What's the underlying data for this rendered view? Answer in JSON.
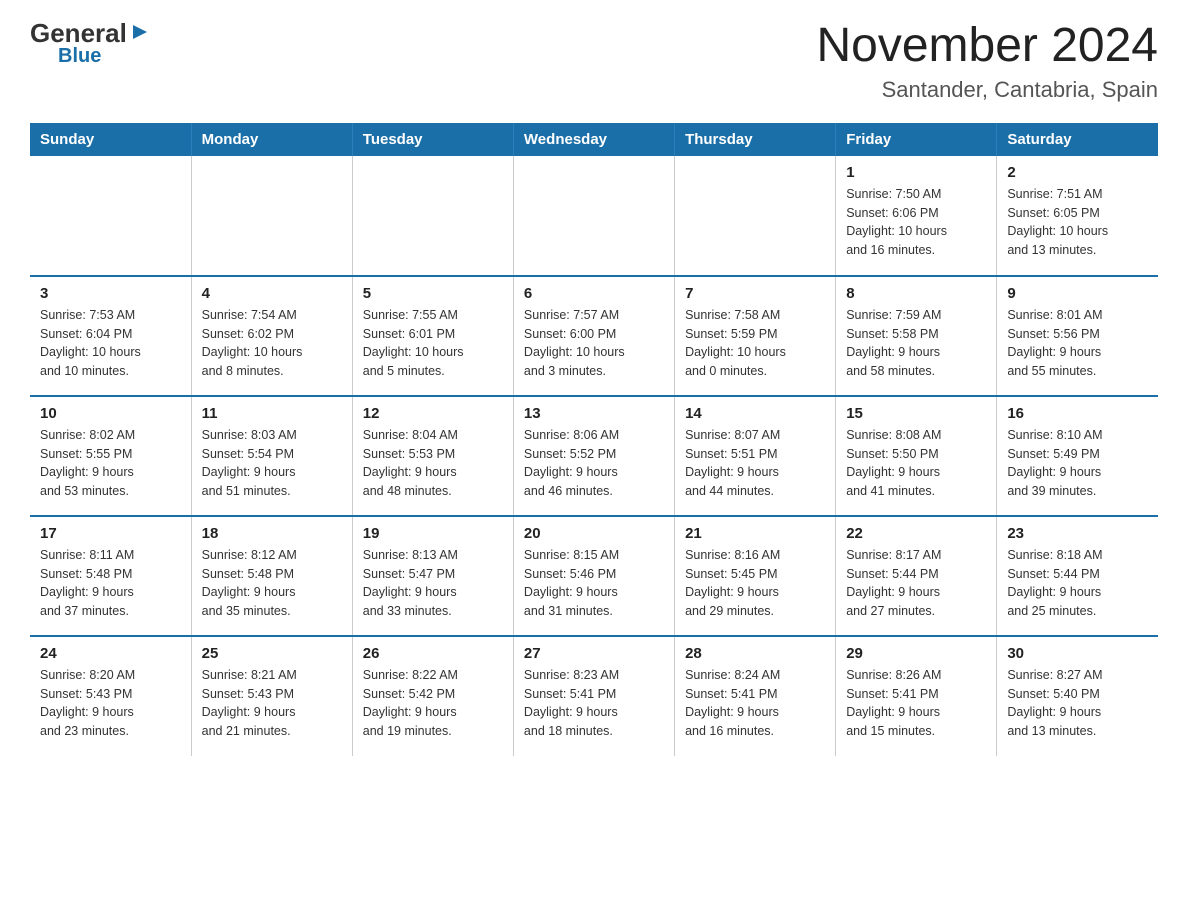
{
  "logo": {
    "general": "General",
    "blue": "Blue",
    "triangle": "▶"
  },
  "title": "November 2024",
  "subtitle": "Santander, Cantabria, Spain",
  "weekdays": [
    "Sunday",
    "Monday",
    "Tuesday",
    "Wednesday",
    "Thursday",
    "Friday",
    "Saturday"
  ],
  "weeks": [
    [
      {
        "day": "",
        "info": ""
      },
      {
        "day": "",
        "info": ""
      },
      {
        "day": "",
        "info": ""
      },
      {
        "day": "",
        "info": ""
      },
      {
        "day": "",
        "info": ""
      },
      {
        "day": "1",
        "info": "Sunrise: 7:50 AM\nSunset: 6:06 PM\nDaylight: 10 hours\nand 16 minutes."
      },
      {
        "day": "2",
        "info": "Sunrise: 7:51 AM\nSunset: 6:05 PM\nDaylight: 10 hours\nand 13 minutes."
      }
    ],
    [
      {
        "day": "3",
        "info": "Sunrise: 7:53 AM\nSunset: 6:04 PM\nDaylight: 10 hours\nand 10 minutes."
      },
      {
        "day": "4",
        "info": "Sunrise: 7:54 AM\nSunset: 6:02 PM\nDaylight: 10 hours\nand 8 minutes."
      },
      {
        "day": "5",
        "info": "Sunrise: 7:55 AM\nSunset: 6:01 PM\nDaylight: 10 hours\nand 5 minutes."
      },
      {
        "day": "6",
        "info": "Sunrise: 7:57 AM\nSunset: 6:00 PM\nDaylight: 10 hours\nand 3 minutes."
      },
      {
        "day": "7",
        "info": "Sunrise: 7:58 AM\nSunset: 5:59 PM\nDaylight: 10 hours\nand 0 minutes."
      },
      {
        "day": "8",
        "info": "Sunrise: 7:59 AM\nSunset: 5:58 PM\nDaylight: 9 hours\nand 58 minutes."
      },
      {
        "day": "9",
        "info": "Sunrise: 8:01 AM\nSunset: 5:56 PM\nDaylight: 9 hours\nand 55 minutes."
      }
    ],
    [
      {
        "day": "10",
        "info": "Sunrise: 8:02 AM\nSunset: 5:55 PM\nDaylight: 9 hours\nand 53 minutes."
      },
      {
        "day": "11",
        "info": "Sunrise: 8:03 AM\nSunset: 5:54 PM\nDaylight: 9 hours\nand 51 minutes."
      },
      {
        "day": "12",
        "info": "Sunrise: 8:04 AM\nSunset: 5:53 PM\nDaylight: 9 hours\nand 48 minutes."
      },
      {
        "day": "13",
        "info": "Sunrise: 8:06 AM\nSunset: 5:52 PM\nDaylight: 9 hours\nand 46 minutes."
      },
      {
        "day": "14",
        "info": "Sunrise: 8:07 AM\nSunset: 5:51 PM\nDaylight: 9 hours\nand 44 minutes."
      },
      {
        "day": "15",
        "info": "Sunrise: 8:08 AM\nSunset: 5:50 PM\nDaylight: 9 hours\nand 41 minutes."
      },
      {
        "day": "16",
        "info": "Sunrise: 8:10 AM\nSunset: 5:49 PM\nDaylight: 9 hours\nand 39 minutes."
      }
    ],
    [
      {
        "day": "17",
        "info": "Sunrise: 8:11 AM\nSunset: 5:48 PM\nDaylight: 9 hours\nand 37 minutes."
      },
      {
        "day": "18",
        "info": "Sunrise: 8:12 AM\nSunset: 5:48 PM\nDaylight: 9 hours\nand 35 minutes."
      },
      {
        "day": "19",
        "info": "Sunrise: 8:13 AM\nSunset: 5:47 PM\nDaylight: 9 hours\nand 33 minutes."
      },
      {
        "day": "20",
        "info": "Sunrise: 8:15 AM\nSunset: 5:46 PM\nDaylight: 9 hours\nand 31 minutes."
      },
      {
        "day": "21",
        "info": "Sunrise: 8:16 AM\nSunset: 5:45 PM\nDaylight: 9 hours\nand 29 minutes."
      },
      {
        "day": "22",
        "info": "Sunrise: 8:17 AM\nSunset: 5:44 PM\nDaylight: 9 hours\nand 27 minutes."
      },
      {
        "day": "23",
        "info": "Sunrise: 8:18 AM\nSunset: 5:44 PM\nDaylight: 9 hours\nand 25 minutes."
      }
    ],
    [
      {
        "day": "24",
        "info": "Sunrise: 8:20 AM\nSunset: 5:43 PM\nDaylight: 9 hours\nand 23 minutes."
      },
      {
        "day": "25",
        "info": "Sunrise: 8:21 AM\nSunset: 5:43 PM\nDaylight: 9 hours\nand 21 minutes."
      },
      {
        "day": "26",
        "info": "Sunrise: 8:22 AM\nSunset: 5:42 PM\nDaylight: 9 hours\nand 19 minutes."
      },
      {
        "day": "27",
        "info": "Sunrise: 8:23 AM\nSunset: 5:41 PM\nDaylight: 9 hours\nand 18 minutes."
      },
      {
        "day": "28",
        "info": "Sunrise: 8:24 AM\nSunset: 5:41 PM\nDaylight: 9 hours\nand 16 minutes."
      },
      {
        "day": "29",
        "info": "Sunrise: 8:26 AM\nSunset: 5:41 PM\nDaylight: 9 hours\nand 15 minutes."
      },
      {
        "day": "30",
        "info": "Sunrise: 8:27 AM\nSunset: 5:40 PM\nDaylight: 9 hours\nand 13 minutes."
      }
    ]
  ]
}
